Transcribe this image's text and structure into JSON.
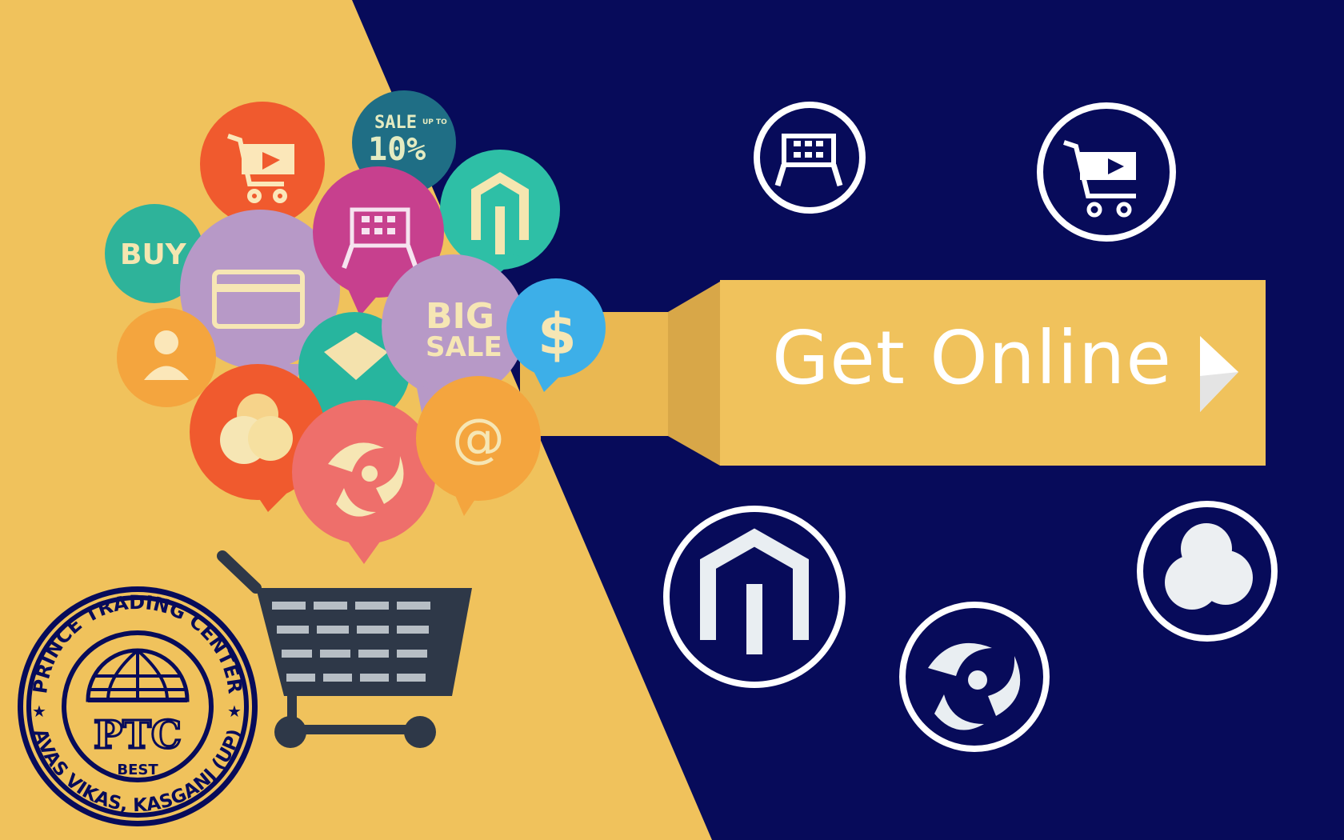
{
  "banner": {
    "cta_label": "Get Online",
    "cta_arrow_icon": "play-arrow-icon",
    "colors": {
      "navy": "#070B5A",
      "gold": "#F0C25C",
      "white": "#FFFFFF"
    }
  },
  "bubbles": {
    "sale_top": "SALE",
    "sale_small": "UP TO",
    "sale_percent": "10%",
    "buy": "BUY",
    "big": "BIG",
    "sale": "SALE",
    "dollar": "$",
    "at": "@"
  },
  "logo": {
    "ring_top": "PRINCE TRADING CENTER",
    "ring_bottom": "AVAS VIKAS, KASGANJ (UP)",
    "monogram": "PTC",
    "tagline": "BEST"
  },
  "icon_circles": [
    "basket-icon",
    "cart-video-icon",
    "magento-icon",
    "swirl-icon",
    "coins-icon"
  ]
}
